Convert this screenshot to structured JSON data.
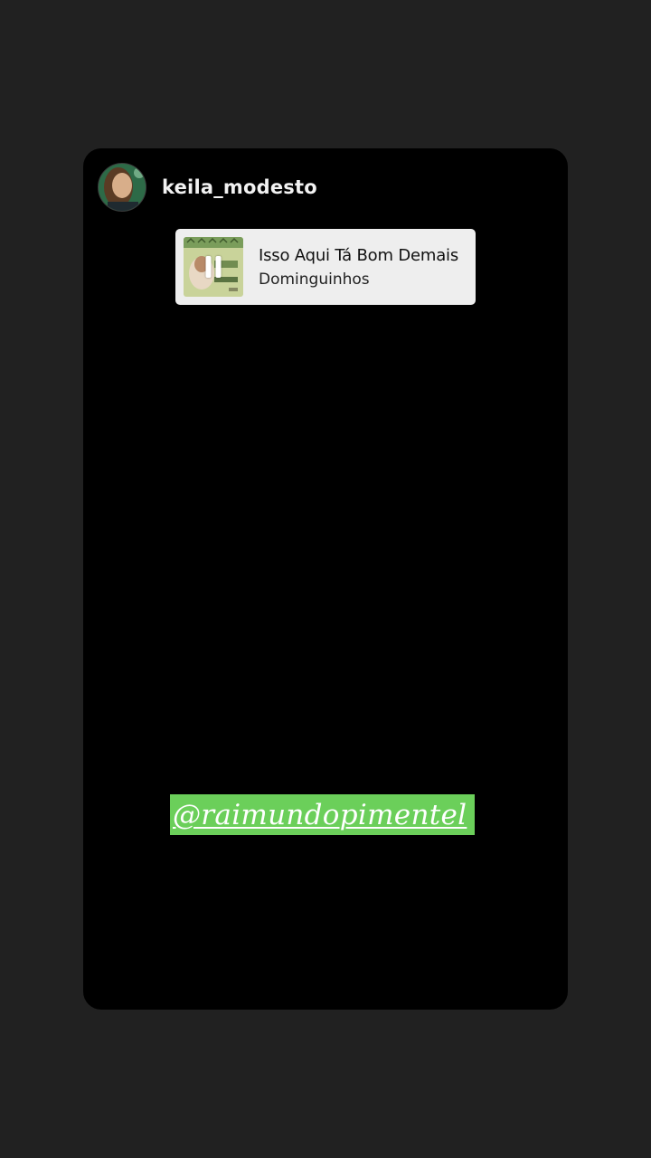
{
  "story": {
    "username": "keila_modesto",
    "avatar_icon": "profile-photo"
  },
  "music": {
    "title": "Isso Aqui Tá Bom Demais",
    "artist": "Dominguinhos",
    "state_icon": "pause-icon"
  },
  "mention": {
    "text": "@raimundopimentel",
    "background_color": "#6bcf5a"
  },
  "colors": {
    "page_background": "#212121",
    "card_background": "#000000",
    "sticker_background": "#eeeeee"
  }
}
